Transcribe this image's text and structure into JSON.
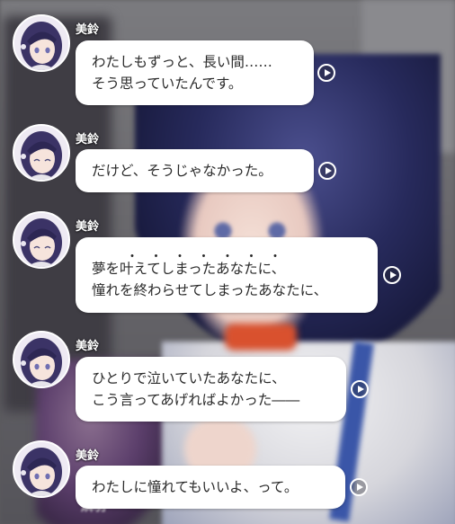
{
  "speaker": "美鈴",
  "messages": [
    {
      "lines": [
        "わたしもずっと、長い間……",
        "そう思っていたんです。"
      ]
    },
    {
      "lines": [
        "だけど、そうじゃなかった。"
      ]
    },
    {
      "lines": [
        "夢を叶えてしまったあなたに、",
        "憧れを終わらせてしまったあなたに、"
      ],
      "emphasis": "・・・・・・・"
    },
    {
      "lines": [
        "ひとりで泣いていたあなたに、",
        "こう言ってあげればよかった――"
      ]
    },
    {
      "lines": [
        "わたしに憧れてもいいよ、って。"
      ]
    }
  ],
  "background_name": "燐羽",
  "icons": {
    "voice": "play-icon",
    "avatar": "character-avatar"
  },
  "colors": {
    "bubble": "#ffffff",
    "text": "#2a2a2a",
    "name": "#ffffff"
  }
}
